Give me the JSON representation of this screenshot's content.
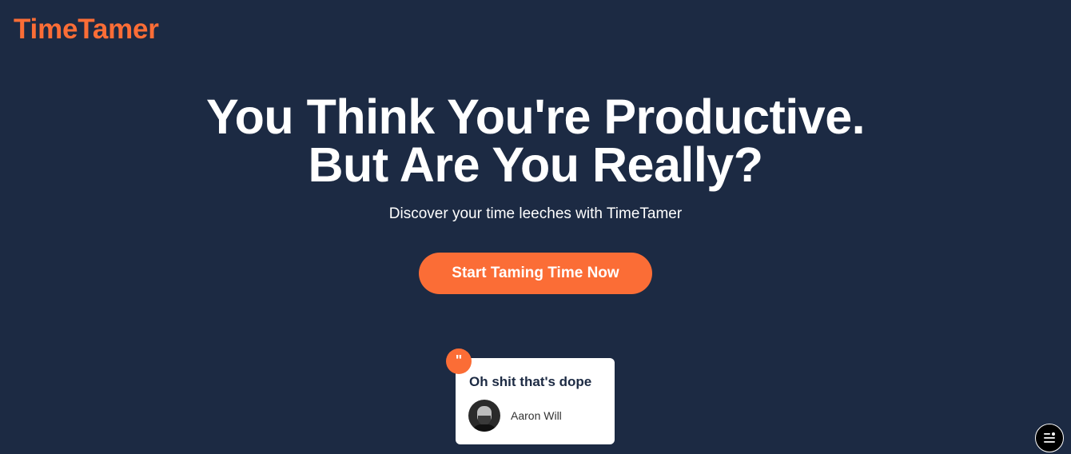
{
  "header": {
    "logo_text": "TimeTamer"
  },
  "hero": {
    "headline_line1": "You Think You're Productive.",
    "headline_line2": "But Are You Really?",
    "subtitle": "Discover your time leeches with TimeTamer",
    "cta_label": "Start Taming Time Now"
  },
  "testimonial": {
    "quote_mark": "\"",
    "quote": "Oh shit that's dope",
    "author": "Aaron Will"
  },
  "floating_menu": {
    "icon": "menu-icon"
  },
  "colors": {
    "background": "#1c2a43",
    "accent": "#fb6d36",
    "text": "#ffffff",
    "card": "#ffffff"
  }
}
